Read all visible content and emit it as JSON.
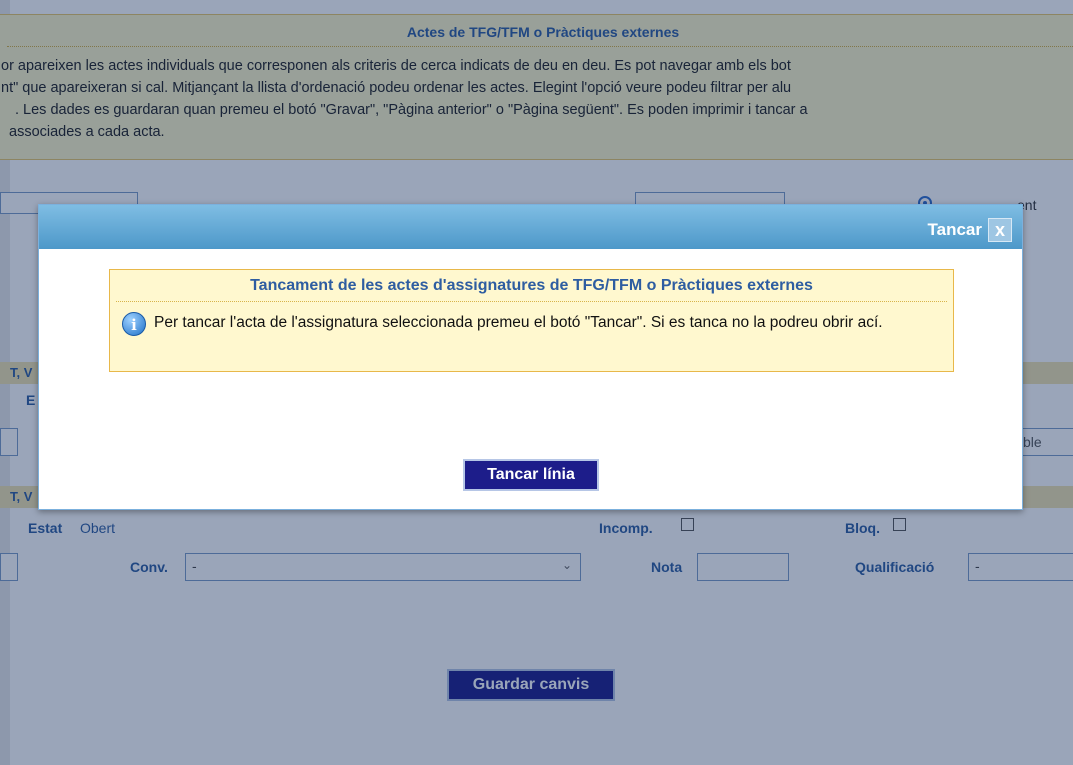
{
  "page": {
    "header_title": "Actes de TFG/TFM o Pràctiques externes",
    "info_lines": [
      "or apareixen les actes individuals que corresponen als criteris de cerca indicats de deu en deu. Es pot navegar amb els bot",
      "nt\" que apareixeran si cal. Mitjançant la llista d'ordenació podeu ordenar les actes. Elegint l'opció veure podeu filtrar per alu",
      ". Les dades es guardaran quan premeu el botó \"Gravar\", \"Pàgina anterior\" o \"Pàgina següent\". Es poden imprimir i tancar a",
      "associades a cada acta."
    ],
    "radio_suffix": "ent",
    "section1_label": "T, V",
    "row_e_label": "E",
    "input_suffix": "ble",
    "section2_label": "T, V",
    "estat_label": "Estat",
    "estat_value": "Obert",
    "incomp_label": "Incomp.",
    "bloq_label": "Bloq.",
    "conv_label": "Conv.",
    "conv_value": "-",
    "nota_label": "Nota",
    "nota_value": "",
    "qualificacio_label": "Qualificació",
    "qualificacio_value": "-",
    "save_label": "Guardar canvis"
  },
  "dialog": {
    "close_label": "Tancar",
    "close_icon": "x",
    "notice_title": "Tancament de les actes d'assignatures de TFG/TFM o Pràctiques externes",
    "notice_text": "Per tancar l'acta de l'assignatura seleccionada premeu el botó \"Tancar\". Si es tanca no la podreu obrir ací.",
    "info_icon": "i",
    "action_label": "Tancar línia"
  },
  "colors": {
    "accent_blue": "#2e5da1",
    "button_navy": "#1d1d8a",
    "notice_bg": "#fff8cf",
    "dialog_header": "#5ca6d4"
  }
}
